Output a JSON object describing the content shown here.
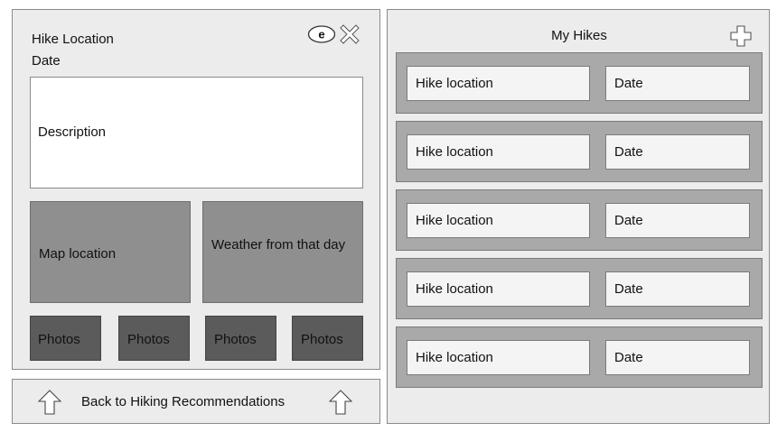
{
  "detail": {
    "hike_location": "Hike Location",
    "date": "Date",
    "edit_icon_letter": "e",
    "description": "Description",
    "map_location": "Map location",
    "weather": "Weather from that day",
    "photos": [
      "Photos",
      "Photos",
      "Photos",
      "Photos"
    ]
  },
  "back_button": {
    "label": "Back to Hiking Recommendations"
  },
  "my_hikes": {
    "title": "My Hikes",
    "rows": [
      {
        "location": "Hike location",
        "date": "Date"
      },
      {
        "location": "Hike location",
        "date": "Date"
      },
      {
        "location": "Hike location",
        "date": "Date"
      },
      {
        "location": "Hike location",
        "date": "Date"
      },
      {
        "location": "Hike location",
        "date": "Date"
      }
    ]
  },
  "icons": {
    "edit": "edit-icon",
    "close": "close-icon",
    "add": "plus-icon",
    "up_arrow": "up-arrow-icon"
  },
  "colors": {
    "panel": "#ececec",
    "map_box": "#8f8f8f",
    "photo_box": "#5b5b5b",
    "row_band": "#a9a9a9"
  }
}
